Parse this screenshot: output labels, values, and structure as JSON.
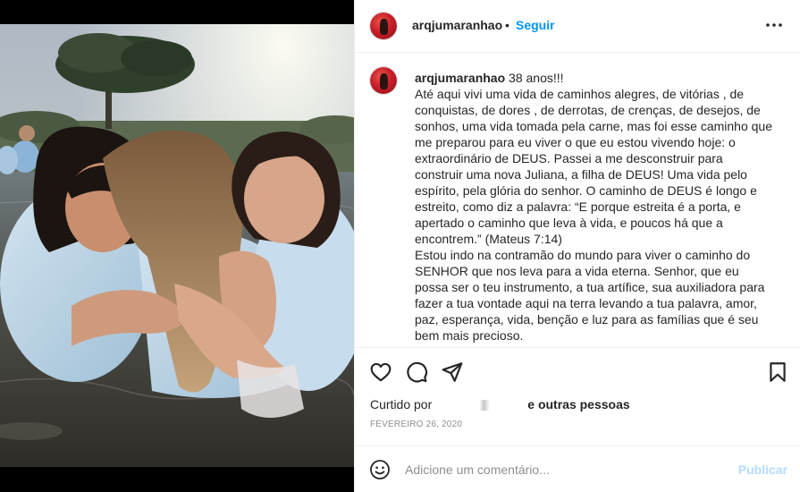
{
  "header": {
    "username": "arqjumaranhao",
    "separator": "•",
    "follow_label": "Seguir",
    "more_icon": "more-options-icon"
  },
  "caption": {
    "username": "arqjumaranhao",
    "text": " 38 anos!!!\nAté aqui vivi uma vida de caminhos alegres, de vitórias , de conquistas, de dores , de derrotas, de crenças, de desejos, de sonhos, uma vida tomada pela carne, mas foi esse caminho que me preparou para eu viver o que eu estou vivendo hoje: o extraordinário de DEUS. Passei a me desconstruir para construir uma nova Juliana, a filha de DEUS! Uma vida pelo espírito, pela glória do senhor. O caminho de DEUS é longo e estreito, como diz a palavra: “E porque estreita é a porta, e apertado o caminho que leva à vida, e poucos há que a encontrem.” (Mateus 7:14)\nEstou indo na contramão do mundo para viver o caminho do SENHOR que nos leva para a vida eterna. Senhor, que eu possa ser o teu instrumento, a tua artífice, sua auxiliadora para fazer a tua vontade aqui na terra levando a tua palavra, amor, paz, esperança, vida, benção e luz para as famílias que é seu bem mais precioso.\nEstou apenas no começo da minha nova vida, minha vida em"
  },
  "actions": {
    "like_icon": "heart-icon",
    "comment_icon": "comment-icon",
    "share_icon": "share-icon",
    "save_icon": "bookmark-icon"
  },
  "likes": {
    "prefix": "Curtido por",
    "suffix": "e outras pessoas"
  },
  "date": "FEVEREIRO 26, 2020",
  "comment_bar": {
    "emoji_icon": "emoji-icon",
    "placeholder": "Adicione um comentário...",
    "publish_label": "Publicar"
  },
  "colors": {
    "accent": "#0095f6",
    "publish_disabled": "#b3dbff",
    "muted": "#8e8e8e",
    "border": "#efefef"
  }
}
